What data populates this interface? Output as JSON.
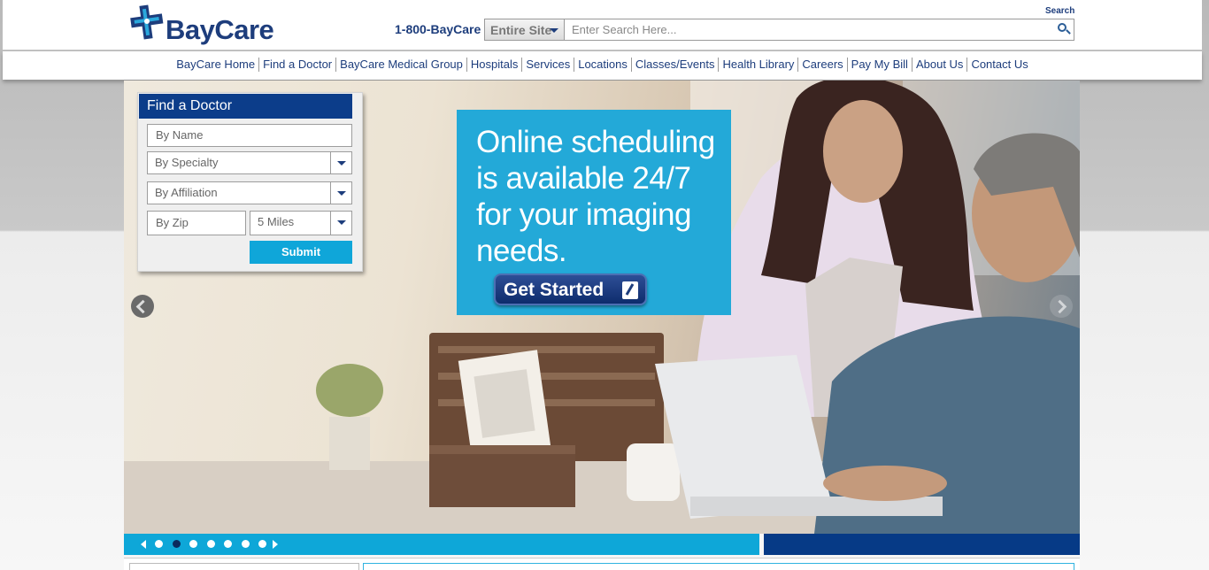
{
  "brand": {
    "name": "BayCare",
    "color": "#1d3d7c",
    "accent": "#0fa6d9"
  },
  "header": {
    "phone": "1-800-BayCare",
    "search_label": "Search",
    "search_scope": "Entire Site",
    "search_placeholder": "Enter Search Here...",
    "search_icon": "magnifier-icon"
  },
  "nav": {
    "items": [
      "BayCare Home",
      "Find a Doctor",
      "BayCare Medical Group",
      "Hospitals",
      "Services",
      "Locations",
      "Classes/Events",
      "Health Library",
      "Careers",
      "Pay My Bill",
      "About Us",
      "Contact Us"
    ]
  },
  "find_doctor": {
    "title": "Find a Doctor",
    "by_name": "By Name",
    "by_specialty": "By Specialty",
    "by_affiliation": "By Affiliation",
    "by_zip": "By Zip",
    "miles": "5 Miles",
    "submit": "Submit"
  },
  "promo": {
    "headline": "Online scheduling is available 24/7 for your imaging needs.",
    "cta": "Get Started",
    "cta_icon": "edit-pencil-icon"
  },
  "carousel": {
    "slide_count": 7,
    "active_index": 1,
    "prev_icon": "triangle-left-icon",
    "next_icon": "triangle-right-icon",
    "hero_prev_icon": "circle-chevron-left-icon",
    "hero_next_icon": "circle-chevron-right-icon"
  }
}
